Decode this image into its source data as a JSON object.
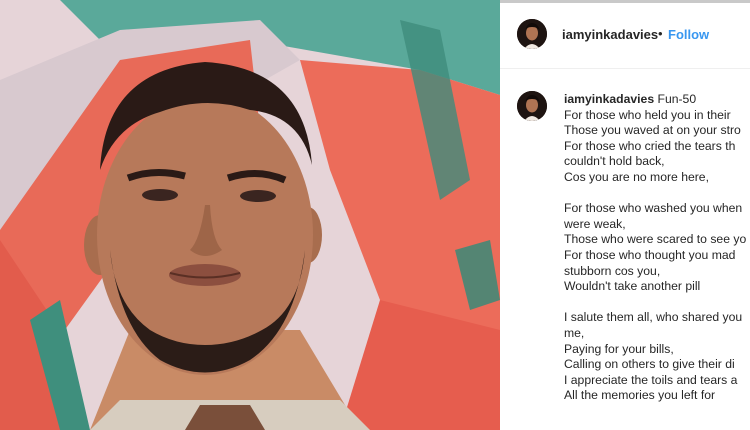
{
  "post": {
    "username": "iamyinkadavies",
    "separator": "•",
    "follow_label": "Follow"
  },
  "caption": {
    "username": "iamyinkadavies",
    "first_text": "Fun-50",
    "lines": [
      "For those who held you in their",
      "Those you waved at on your stro",
      "For those who cried the tears th",
      "couldn't hold back,",
      "Cos you are no more here,",
      "",
      "For those who washed you when",
      "were weak,",
      "Those who were scared to see yo",
      "For those who thought you mad",
      "stubborn cos you,",
      "Wouldn't take another pill",
      "",
      "I salute them all, who shared you",
      "me,",
      "Paying for your bills,",
      "Calling on others to give their di",
      "I appreciate the toils and tears a",
      "All the memories you left for"
    ]
  },
  "icons": {
    "profile_avatar": "profile-avatar-icon",
    "caption_avatar": "caption-avatar-icon"
  },
  "colors": {
    "follow": "#3897f0",
    "text": "#262626",
    "divider": "#efefef"
  }
}
